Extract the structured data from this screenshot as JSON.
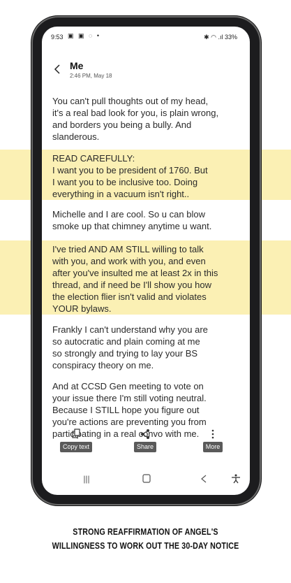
{
  "status": {
    "time": "9:53",
    "left_icons": "▣ ▣ ◌ •",
    "right": "✱ ◠ .ıl 33%"
  },
  "header": {
    "title": "Me",
    "subtitle": "2:46 PM, May 18"
  },
  "messages": [
    {
      "lines": [
        "You can't pull thoughts out of my head,",
        "it's a real bad look for you, is plain wrong,",
        "and borders you being a bully. And",
        "slanderous."
      ]
    },
    {
      "lines": [
        "READ CAREFULLY:",
        "I want you to be president of 1760. But",
        "I want you to be inclusive too. Doing",
        "everything in a vacuum isn't right.."
      ]
    },
    {
      "lines": [
        "Michelle and I are cool. So u can blow",
        "smoke up that chimney anytime u want."
      ]
    },
    {
      "lines": [
        "I've tried AND AM STILL willing to talk",
        "with you, and work with you, and even",
        "after you've insulted me at least 2x in this",
        "thread, and if need be I'll show you how",
        "the election flier isn't valid and violates",
        "YOUR bylaws."
      ]
    },
    {
      "lines": [
        "Frankly I can't understand why you are",
        "so autocratic and plain coming at me",
        "so strongly and trying to lay your BS",
        "conspiracy theory on me."
      ]
    },
    {
      "lines": [
        "And at CCSD Gen meeting to vote on",
        "your issue there I'm still voting neutral.",
        "Because I STILL hope you figure out",
        "you're actions are preventing you from",
        "participating in a real convo with me."
      ]
    }
  ],
  "toolbar": {
    "copy_label": "Copy text",
    "share_label": "Share",
    "more_label": "More"
  },
  "icons": {
    "back": "back-icon",
    "copy": "copy-icon",
    "share": "share-icon",
    "more": "more-icon",
    "recents": "recents-icon",
    "home": "home-icon",
    "nav_back": "nav-back-icon",
    "accessibility": "accessibility-icon"
  },
  "colors": {
    "highlight": "#fbf0b4",
    "label_bg": "#5a5a5a"
  },
  "caption": {
    "line1": "STRONG REAFFIRMATION OF ANGEL'S",
    "line2": "WILLINGNESS TO WORK OUT THE 30-DAY NOTICE"
  }
}
